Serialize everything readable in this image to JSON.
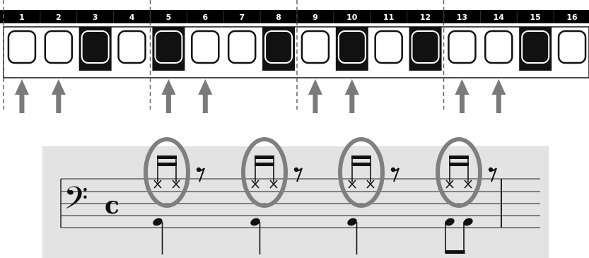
{
  "sequencer": {
    "steps": [
      {
        "number": "1",
        "lit": false,
        "arrow": true
      },
      {
        "number": "2",
        "lit": false,
        "arrow": true
      },
      {
        "number": "3",
        "lit": true,
        "arrow": false
      },
      {
        "number": "4",
        "lit": false,
        "arrow": false
      },
      {
        "number": "5",
        "lit": true,
        "arrow": true
      },
      {
        "number": "6",
        "lit": false,
        "arrow": true
      },
      {
        "number": "7",
        "lit": false,
        "arrow": false
      },
      {
        "number": "8",
        "lit": true,
        "arrow": false
      },
      {
        "number": "9",
        "lit": false,
        "arrow": true
      },
      {
        "number": "10",
        "lit": true,
        "arrow": true
      },
      {
        "number": "11",
        "lit": false,
        "arrow": false
      },
      {
        "number": "12",
        "lit": true,
        "arrow": false
      },
      {
        "number": "13",
        "lit": false,
        "arrow": true
      },
      {
        "number": "14",
        "lit": false,
        "arrow": true
      },
      {
        "number": "15",
        "lit": true,
        "arrow": false
      },
      {
        "number": "16",
        "lit": false,
        "arrow": false
      }
    ]
  },
  "notation": {
    "clef": "𝄢",
    "time_signature": "c",
    "beats": [
      {
        "highlighted": true,
        "bass_notes": 1
      },
      {
        "highlighted": true,
        "bass_notes": 1
      },
      {
        "highlighted": true,
        "bass_notes": 1
      },
      {
        "highlighted": true,
        "bass_notes": 2
      }
    ]
  },
  "colors": {
    "strip": "#000000",
    "button_border": "#111111",
    "lit_button": "#111111",
    "arrow": "#7a7a7a",
    "highlight_ring": "#7f7f7f",
    "staff_background": "#e3e3e3",
    "dashed_separator": "#666666"
  }
}
